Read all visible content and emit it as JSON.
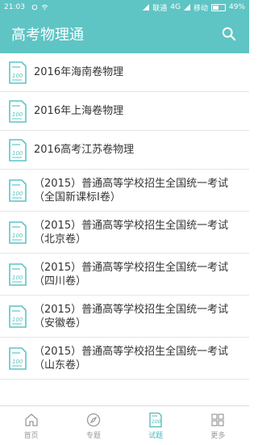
{
  "status_bar": {
    "time": "21:03",
    "carrier1": "联通",
    "network": "4G",
    "carrier2": "移动",
    "battery": "49%"
  },
  "app_bar": {
    "title": "高考物理通",
    "search_icon": "search-icon"
  },
  "items": [
    {
      "line1": "2016年海南卷物理",
      "line2": ""
    },
    {
      "line1": "2016年上海卷物理",
      "line2": ""
    },
    {
      "line1": "2016高考江苏卷物理",
      "line2": ""
    },
    {
      "line1": "（2015）普通高等学校招生全国统一考试",
      "line2": "（全国新课标Ⅰ卷）"
    },
    {
      "line1": "（2015）普通高等学校招生全国统一考试",
      "line2": "（北京卷）"
    },
    {
      "line1": "（2015）普通高等学校招生全国统一考试",
      "line2": "（四川卷）"
    },
    {
      "line1": "（2015）普通高等学校招生全国统一考试",
      "line2": "（安徽卷）"
    },
    {
      "line1": "（2015）普通高等学校招生全国统一考试",
      "line2": "（山东卷）"
    }
  ],
  "tabs": [
    {
      "label": "首页",
      "icon": "home-icon"
    },
    {
      "label": "专题",
      "icon": "compass-icon"
    },
    {
      "label": "试题",
      "icon": "exam-doc-icon"
    },
    {
      "label": "更多",
      "icon": "grid-icon"
    }
  ],
  "colors": {
    "accent": "#5fc4c4",
    "active_tab": "#4bb8b8"
  }
}
